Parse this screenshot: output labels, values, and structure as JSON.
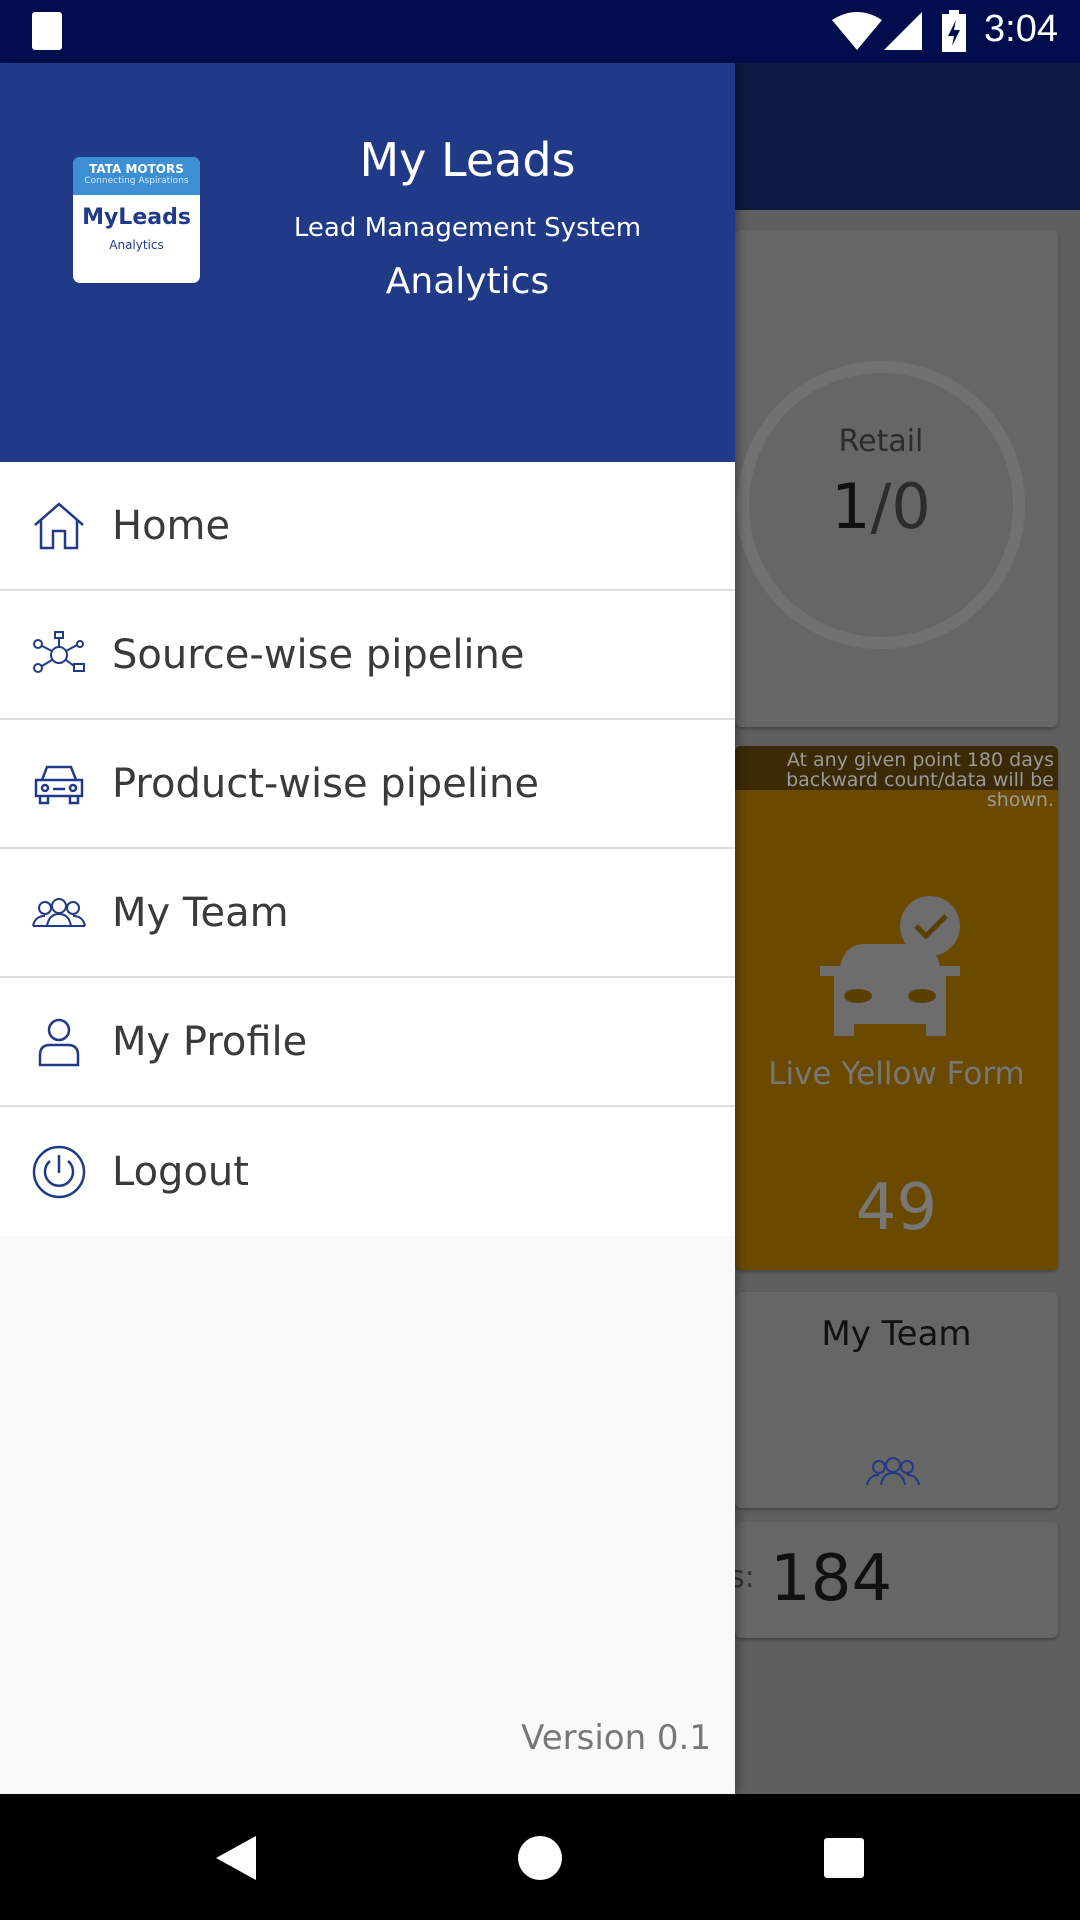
{
  "status_bar": {
    "time": "3:04"
  },
  "drawer": {
    "logo": {
      "brand": "TATA MOTORS",
      "tagline": "Connecting Aspirations",
      "product": "MyLeads",
      "sub": "Analytics"
    },
    "title": "My Leads",
    "subtitle": "Lead Management System",
    "section": "Analytics",
    "items": [
      {
        "label": "Home",
        "icon": "home-icon"
      },
      {
        "label": "Source-wise pipeline",
        "icon": "network-icon"
      },
      {
        "label": "Product-wise pipeline",
        "icon": "car-icon"
      },
      {
        "label": "My Team",
        "icon": "team-icon"
      },
      {
        "label": "My Profile",
        "icon": "user-icon"
      },
      {
        "label": "Logout",
        "icon": "power-icon"
      }
    ],
    "version": "Version 0.1"
  },
  "background": {
    "retail_label": "Retail",
    "retail_value": "1",
    "retail_target": "/0",
    "notice": "At any given point 180 days backward count/data will be shown.",
    "yellow_form_label": "Live Yellow Form",
    "yellow_form_count": "49",
    "team_label": "My Team",
    "total_prefix": "s:",
    "total_value": "184"
  },
  "colors": {
    "header": "#213a87",
    "yellow": "#6b4a00",
    "icon": "#213a87"
  }
}
